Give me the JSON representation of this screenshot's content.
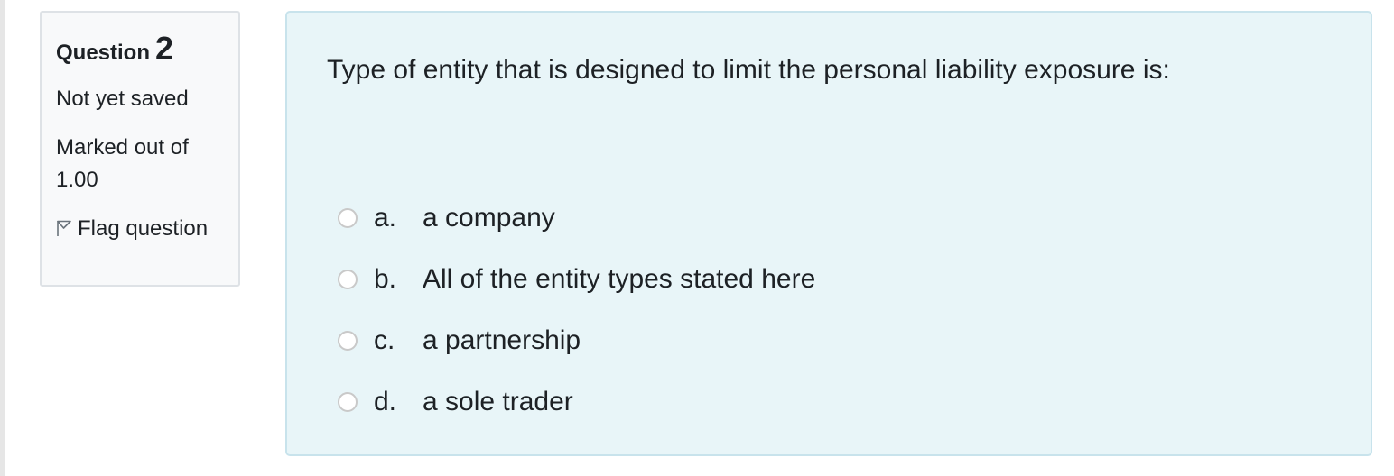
{
  "info": {
    "question_word": "Question",
    "question_number": "2",
    "state": "Not yet saved",
    "grade": "Marked out of 1.00",
    "flag_label": "Flag question",
    "flag_icon": "flag-icon"
  },
  "question": {
    "text": "Type of entity that is designed to limit the personal liability exposure is:",
    "answers": [
      {
        "letter": "a.",
        "text": "a company"
      },
      {
        "letter": "b.",
        "text": "All of the entity types stated here"
      },
      {
        "letter": "c.",
        "text": "a partnership"
      },
      {
        "letter": "d.",
        "text": "a sole trader"
      }
    ]
  },
  "colors": {
    "panel_bg": "#e8f5f8",
    "panel_border": "#c8e3ec",
    "info_bg": "#f8f9fa",
    "text": "#1d2125"
  }
}
